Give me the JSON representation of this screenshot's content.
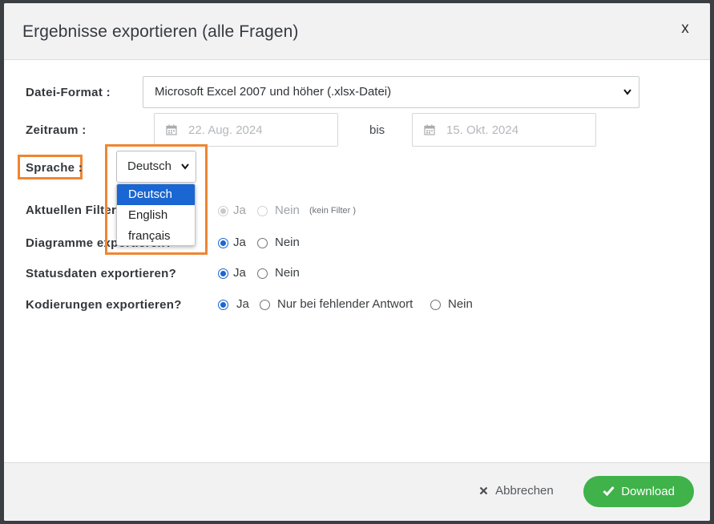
{
  "dialog": {
    "title": "Ergebnisse exportieren (alle Fragen)",
    "close_label": "x"
  },
  "format": {
    "label": "Datei-Format :",
    "value": "Microsoft Excel 2007 und höher (.xlsx-Datei)"
  },
  "zeitraum": {
    "label": "Zeitraum :",
    "from_placeholder": "22. Aug. 2024",
    "to_placeholder": "15. Okt. 2024",
    "separator": "bis"
  },
  "sprache": {
    "label": "Sprache :",
    "value": "Deutsch",
    "options": [
      "Deutsch",
      "English",
      "français"
    ],
    "selected_index": 0
  },
  "filter": {
    "label": "Aktuellen Filter",
    "yes": "Ja",
    "no": "Nein",
    "note": "(kein Filter )",
    "selected": "Ja",
    "disabled": true
  },
  "diagramme": {
    "label": "Diagramme exportieren?",
    "yes": "Ja",
    "no": "Nein",
    "selected": "Ja"
  },
  "statusdaten": {
    "label": "Statusdaten exportieren?",
    "yes": "Ja",
    "no": "Nein",
    "selected": "Ja"
  },
  "kodierungen": {
    "label": "Kodierungen exportieren?",
    "yes": "Ja",
    "partial": "Nur bei fehlender Antwort",
    "no": "Nein",
    "selected": "Ja"
  },
  "footer": {
    "cancel_label": "Abbrechen",
    "download_label": "Download"
  },
  "colors": {
    "highlight": "#ef8532",
    "primary": "#1a66d2",
    "download": "#3fb24a"
  }
}
